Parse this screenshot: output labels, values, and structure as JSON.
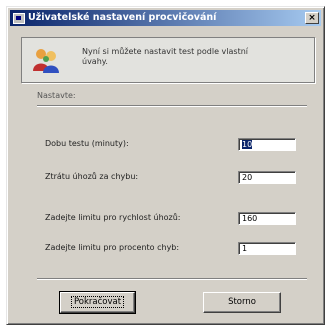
{
  "window": {
    "title": "Uživatelské nastavení procvičování",
    "close_label": "×"
  },
  "info": {
    "icon": "people-icon",
    "text": "Nyní si můžete nastavit test podle vlastní úvahy."
  },
  "settings": {
    "heading": "Nastavte:",
    "fields": [
      {
        "label": "Dobu testu (minuty):",
        "value": "10"
      },
      {
        "label": "Ztrátu úhozů za chybu:",
        "value": "20"
      },
      {
        "label": "Zadejte limitu pro rychlost úhozů:",
        "value": "160"
      },
      {
        "label": "Zadejte limitu pro procento chyb:",
        "value": "1"
      }
    ]
  },
  "buttons": {
    "continue": "Pokračovat",
    "cancel": "Storno"
  },
  "colors": {
    "title_start": "#0a246a",
    "title_end": "#a6caf0",
    "face": "#d4d0c8"
  }
}
